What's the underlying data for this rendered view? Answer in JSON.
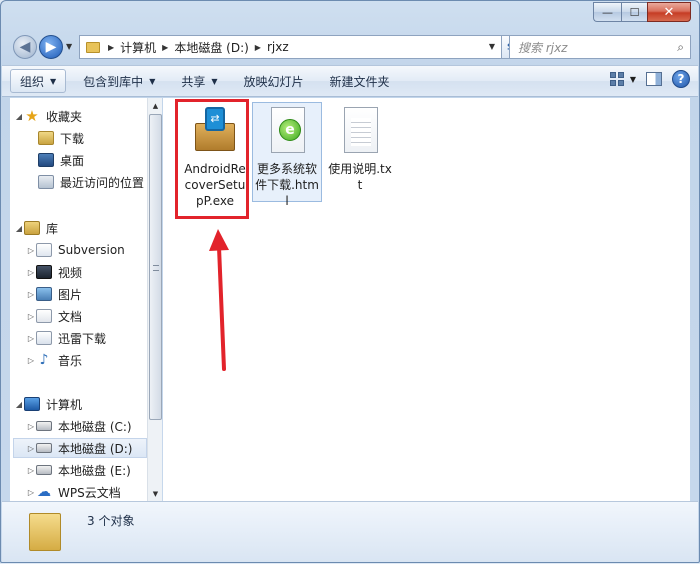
{
  "window": {
    "caption": {
      "minimize": "—",
      "maximize": "☐",
      "close": "✕"
    }
  },
  "address_bar": {
    "crumbs": [
      "计算机",
      "本地磁盘 (D:)",
      "rjxz"
    ],
    "search_placeholder": "搜索 rjxz"
  },
  "toolbar": {
    "organize": "组织",
    "include_in_library": "包含到库中",
    "share": "共享",
    "slideshow": "放映幻灯片",
    "new_folder": "新建文件夹"
  },
  "nav": {
    "favorites": "收藏夹",
    "downloads": "下载",
    "desktop": "桌面",
    "recent": "最近访问的位置",
    "libraries": "库",
    "subversion": "Subversion",
    "videos": "视频",
    "pictures": "图片",
    "documents": "文档",
    "xunlei": "迅雷下载",
    "music": "音乐",
    "computer": "计算机",
    "drive_c": "本地磁盘 (C:)",
    "drive_d": "本地磁盘 (D:)",
    "drive_e": "本地磁盘 (E:)",
    "wps": "WPS云文档"
  },
  "files": [
    {
      "name": "AndroidRecoverSetupP.exe",
      "icon": "installer-icon"
    },
    {
      "name": "更多系统软件下载.html",
      "icon": "html-file-icon"
    },
    {
      "name": "使用说明.txt",
      "icon": "text-file-icon"
    }
  ],
  "status": {
    "count": "3 个对象"
  },
  "colors": {
    "highlight": "#e2232b",
    "selection": "#dce7f5"
  }
}
